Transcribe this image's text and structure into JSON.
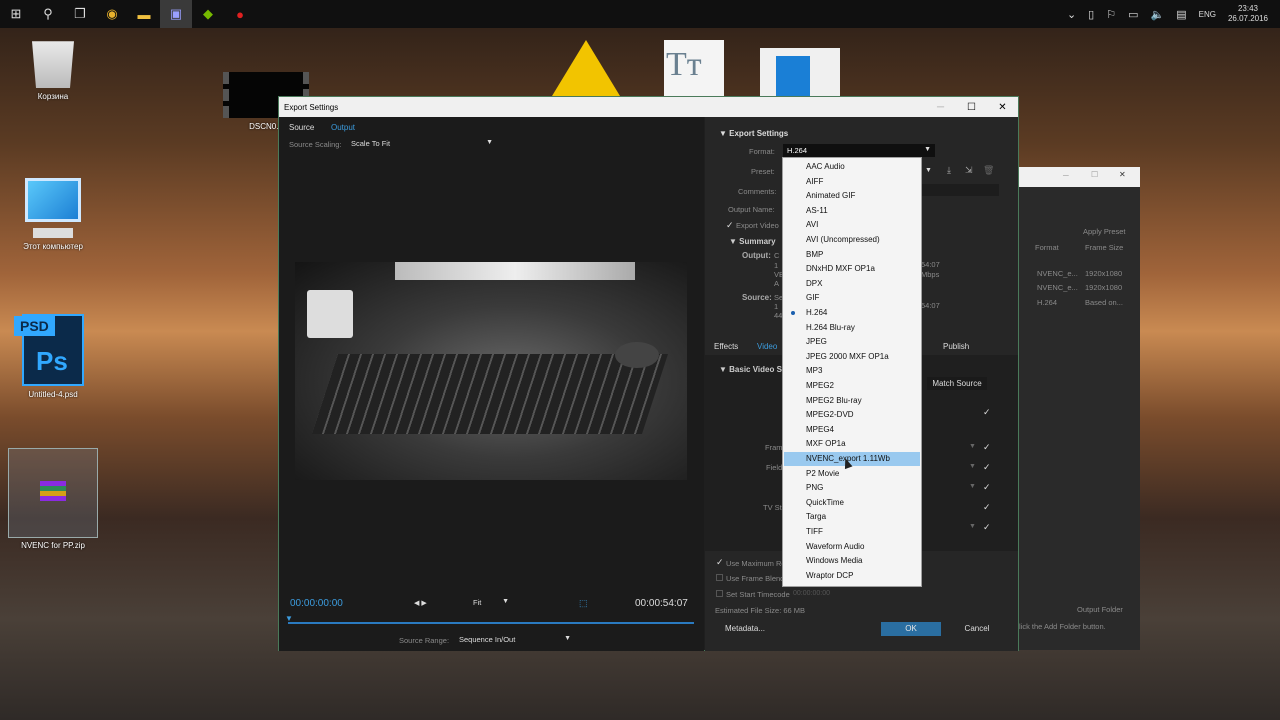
{
  "taskbar": {
    "lang": "ENG",
    "time": "23:43",
    "date": "26.07.2016"
  },
  "desktop": {
    "icons": [
      {
        "label": "Корзина"
      },
      {
        "label": "Этот компьютер"
      },
      {
        "label": "Untitled-4.psd"
      },
      {
        "label": "NVENC for PP.zip"
      },
      {
        "label": "DSCN0..."
      }
    ],
    "psd_badge": "PSD",
    "ps_logo": "Ps"
  },
  "dialog": {
    "title": "Export Settings",
    "left": {
      "tabs": [
        "Source",
        "Output"
      ],
      "source_scaling_label": "Source Scaling:",
      "source_scaling_value": "Scale To Fit",
      "timecode_start": "00:00:00:00",
      "timecode_end": "00:00:54:07",
      "fit_label": "Fit",
      "source_range_label": "Source Range:",
      "source_range_value": "Sequence In/Out"
    },
    "right": {
      "section_title": "Export Settings",
      "format_label": "Format:",
      "format_value": "H.264",
      "preset_label": "Preset:",
      "comments_label": "Comments:",
      "output_name_label": "Output Name:",
      "export_video_label": "Export Video",
      "summary_label": "Summary",
      "output_label": "Output:",
      "source_label": "Source:",
      "summary_snippets": [
        "C",
        "1",
        "VB",
        "A",
        "54:07",
        "Mbps",
        "Se",
        "1",
        "44",
        "54:07"
      ],
      "tabs": [
        "Effects",
        "Video",
        "Publish"
      ],
      "basic_video_label": "Basic Video Se",
      "match_source_label": "Match Source",
      "row_labels": [
        "Fram",
        "Field",
        "TV St"
      ],
      "use_max_render": "Use Maximum Re",
      "use_frame_blend": "Use Frame Blend",
      "set_start_timecode": "Set Start Timecode",
      "start_timecode_value": "00:00:00:00",
      "estimated_file_size": "Estimated File Size:  66 MB",
      "metadata_button": "Metadata...",
      "ok_button": "OK",
      "cancel_button": "Cancel"
    }
  },
  "format_dropdown": {
    "selected": "H.264",
    "highlighted": "NVENC_export 1.11Wb",
    "options": [
      "AAC Audio",
      "AIFF",
      "Animated GIF",
      "AS-11",
      "AVI",
      "AVI (Uncompressed)",
      "BMP",
      "DNxHD MXF OP1a",
      "DPX",
      "GIF",
      "H.264",
      "H.264 Blu-ray",
      "JPEG",
      "JPEG 2000 MXF OP1a",
      "MP3",
      "MPEG2",
      "MPEG2 Blu-ray",
      "MPEG2-DVD",
      "MPEG4",
      "MXF OP1a",
      "NVENC_export 1.11Wb",
      "P2 Movie",
      "PNG",
      "QuickTime",
      "Targa",
      "TIFF",
      "Waveform Audio",
      "Windows Media",
      "Wraptor DCP"
    ]
  },
  "bg_window": {
    "apply_preset": "Apply Preset",
    "col_format": "Format",
    "col_frame_size": "Frame Size",
    "rows": [
      [
        "NVENC_e...",
        "1920x1080"
      ],
      [
        "NVENC_e...",
        "1920x1080"
      ],
      [
        "H.264",
        "Based on..."
      ]
    ],
    "output_folder": "Output Folder",
    "hint": "lick the Add Folder button."
  },
  "colors": {
    "accent_blue": "#3c9cde",
    "highlight": "#99c9ef",
    "dialog_bg": "#1f1f1f"
  }
}
